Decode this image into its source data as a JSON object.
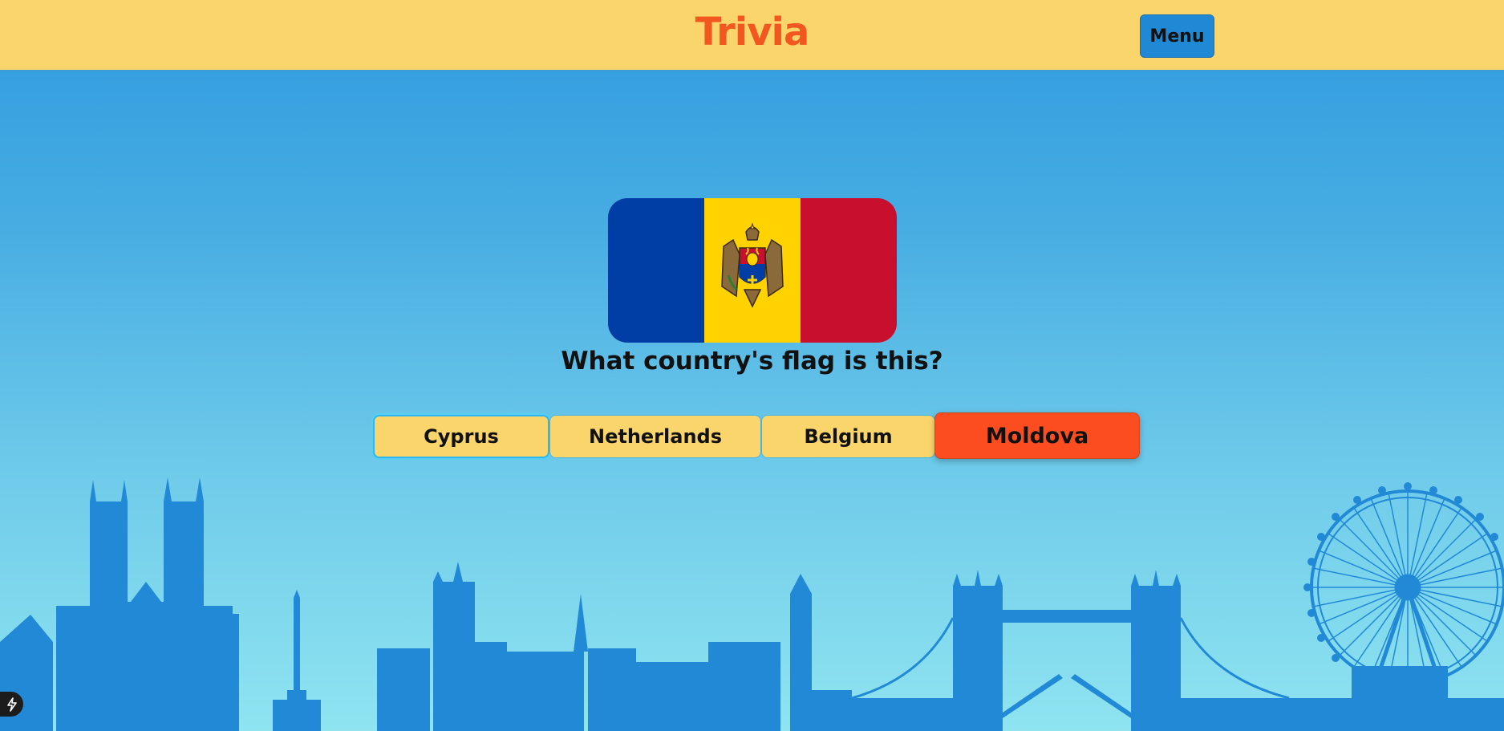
{
  "header": {
    "title": "Trivia",
    "menu_label": "Menu"
  },
  "question": {
    "text": "What country's flag is this?",
    "flag": {
      "country_icon": "moldova-flag",
      "stripe_colors": [
        "#003da5",
        "#ffd200",
        "#c8102e"
      ]
    }
  },
  "answers": [
    {
      "label": "Cyprus",
      "state": "focused"
    },
    {
      "label": "Netherlands",
      "state": "default"
    },
    {
      "label": "Belgium",
      "state": "default"
    },
    {
      "label": "Moldova",
      "state": "selected"
    }
  ],
  "colors": {
    "header_bg": "#fad56b",
    "title": "#f2571f",
    "accent_blue": "#2089d6",
    "selected_answer": "#fb4d1f",
    "skyline": "#2089d6"
  },
  "icons": {
    "dev_badge": "lightning-icon"
  }
}
